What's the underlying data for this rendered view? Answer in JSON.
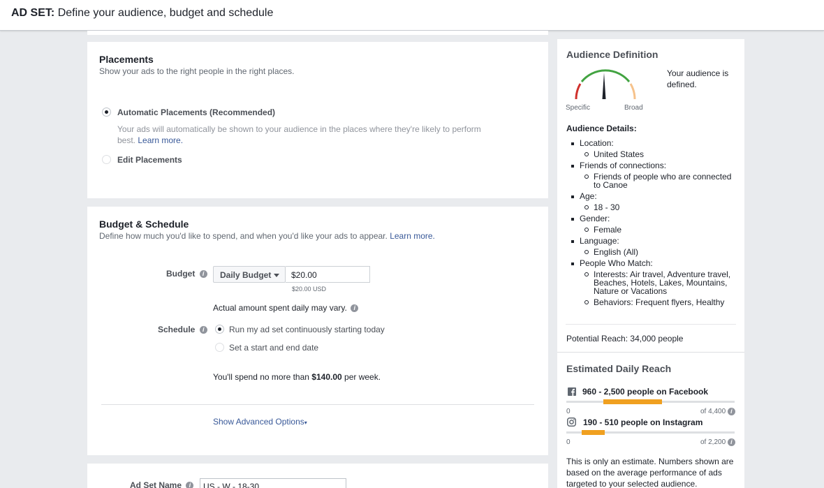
{
  "header": {
    "prefix": "AD SET:",
    "subtitle": "Define your audience, budget and schedule"
  },
  "placements": {
    "title": "Placements",
    "subtitle": "Show your ads to the right people in the right places.",
    "auto_label": "Automatic Placements (Recommended)",
    "auto_desc_line1": "Your ads will automatically be shown to your audience in the places where they're likely to perform",
    "auto_desc_line2": "best.",
    "learn_more": "Learn more.",
    "edit_label": "Edit Placements"
  },
  "budget": {
    "title": "Budget & Schedule",
    "subtitle": "Define how much you'd like to spend, and when you'd like your ads to appear.",
    "learn_more": "Learn more.",
    "budget_label": "Budget",
    "budget_type": "Daily Budget",
    "amount": "$20.00",
    "amount_note": "$20.00 USD",
    "vary_note": "Actual amount spent daily may vary.",
    "schedule_label": "Schedule",
    "schedule_option1": "Run my ad set continuously starting today",
    "schedule_option2": "Set a start and end date",
    "spend_prefix": "You'll spend no more than",
    "spend_amount": "$140.00",
    "spend_suffix": "per week.",
    "advanced": "Show Advanced Options"
  },
  "adset_name": {
    "label": "Ad Set Name",
    "value": "US - W - 18-30"
  },
  "audience": {
    "title": "Audience Definition",
    "gauge_specific": "Specific",
    "gauge_broad": "Broad",
    "status_line1": "Your audience is",
    "status_line2": "defined.",
    "details_title": "Audience Details:",
    "location_label": "Location:",
    "location_value": "United States",
    "friends_label": "Friends of connections:",
    "friends_value_line1": "Friends of people who are connected",
    "friends_value_line2": "to Canoe",
    "age_label": "Age:",
    "age_value": "18 - 30",
    "gender_label": "Gender:",
    "gender_value": "Female",
    "language_label": "Language:",
    "language_value": "English (All)",
    "match_label": "People Who Match:",
    "interests_line1": "Interests: Air travel, Adventure travel,",
    "interests_line2": "Beaches, Hotels, Lakes, Mountains,",
    "interests_line3": "Nature or Vacations",
    "behaviors_line1": "Behaviors: Frequent flyers, Healthy",
    "potential_reach": "Potential Reach: 34,000 people"
  },
  "reach": {
    "title": "Estimated Daily Reach",
    "facebook_range": "960 - 2,500 people on Facebook",
    "facebook_min": "0",
    "facebook_max": "of 4,400",
    "facebook_fill_start": 0.22,
    "facebook_fill_end": 0.57,
    "instagram_range": "190 - 510 people on Instagram",
    "instagram_min": "0",
    "instagram_max": "of 2,200",
    "instagram_fill_start": 0.09,
    "instagram_fill_end": 0.23,
    "estimate_line1": "This is only an estimate. Numbers shown are",
    "estimate_line2": "based on the average performance of ads",
    "estimate_line3": "targeted to your selected audience."
  },
  "colors": {
    "link": "#385898",
    "gauge_red": "#d0312d",
    "gauge_green": "#42a341",
    "gauge_orange": "#f6c28b",
    "reach_fill": "#f0a020"
  }
}
